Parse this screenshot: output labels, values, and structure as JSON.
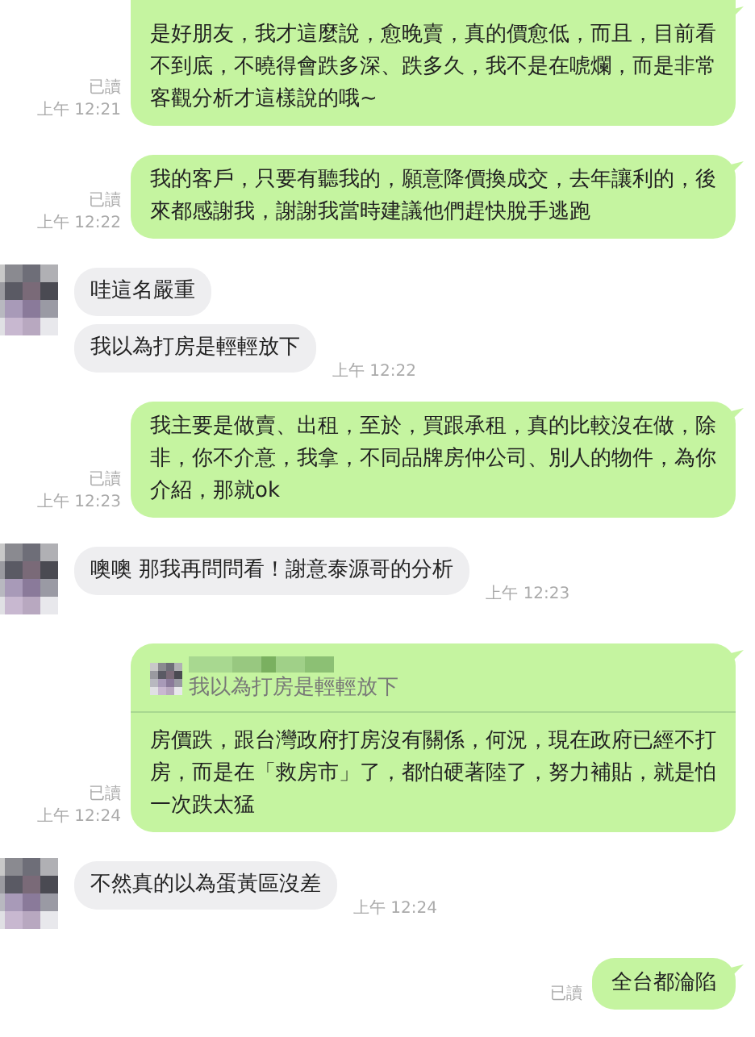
{
  "messages": [
    {
      "kind": "sent",
      "read": "已讀",
      "time": "上午 12:21",
      "text": "是好朋友，我才這麼說，愈晚賣，真的價愈低，而且，目前看不到底，不曉得會跌多深、跌多久，我不是在唬爛，而是非常客觀分析才這樣說的哦~"
    },
    {
      "kind": "sent",
      "read": "已讀",
      "time": "上午 12:22",
      "text": "我的客戶，只要有聽我的，願意降價換成交，去年讓利的，後來都感謝我，謝謝我當時建議他們趕快脫手逃跑"
    },
    {
      "kind": "received",
      "time": "上午 12:22",
      "texts": [
        "哇這名嚴重",
        "我以為打房是輕輕放下"
      ]
    },
    {
      "kind": "sent",
      "read": "已讀",
      "time": "上午 12:23",
      "text": "我主要是做賣、出租，至於，買跟承租，真的比較沒在做，除非，你不介意，我拿，不同品牌房仲公司、別人的物件，為你介紹，那就ok"
    },
    {
      "kind": "received",
      "time": "上午 12:23",
      "texts": [
        "噢噢 那我再問問看！謝意泰源哥的分析"
      ]
    },
    {
      "kind": "sent",
      "read": "已讀",
      "time": "上午 12:24",
      "quote": "我以為打房是輕輕放下",
      "text": "房價跌，跟台灣政府打房沒有關係，何況，現在政府已經不打房，而是在「救房市」了，都怕硬著陸了，努力補貼，就是怕一次跌太猛"
    },
    {
      "kind": "received",
      "time": "上午 12:24",
      "texts": [
        "不然真的以為蛋黃區沒差"
      ]
    },
    {
      "kind": "sent",
      "read": "已讀",
      "text": "全台都淪陷"
    }
  ]
}
